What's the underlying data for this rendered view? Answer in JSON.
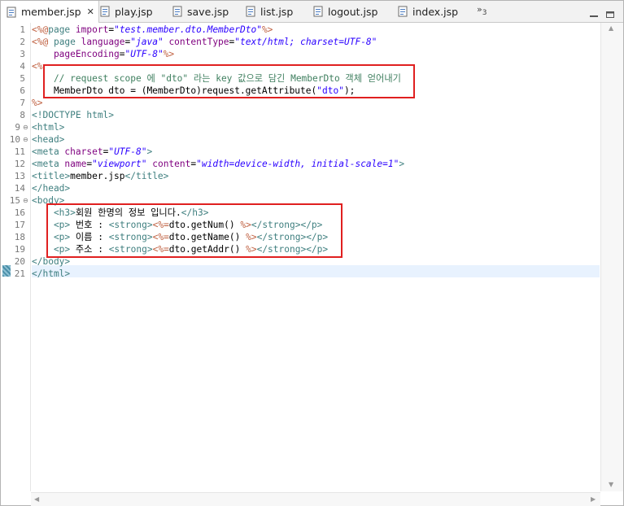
{
  "tabs": [
    {
      "label": "member.jsp",
      "active": true
    },
    {
      "label": "play.jsp"
    },
    {
      "label": "save.jsp"
    },
    {
      "label": "list.jsp"
    },
    {
      "label": "logout.jsp"
    },
    {
      "label": "index.jsp"
    }
  ],
  "overflow": {
    "glyph": "»",
    "count": "3"
  },
  "line_numbers": [
    "1",
    "2",
    "3",
    "4",
    "5",
    "6",
    "7",
    "8",
    "9",
    "10",
    "11",
    "12",
    "13",
    "14",
    "15",
    "16",
    "17",
    "18",
    "19",
    "20",
    "21"
  ],
  "code": {
    "l1": {
      "a": "<%@",
      "b": "page ",
      "c": "import",
      "d": "=",
      "e": "\"test.member.dto.MemberDto\"",
      "f": "%>"
    },
    "l2": {
      "a": "<%@",
      "b": " page ",
      "c": "language",
      "d": "=",
      "e": "\"java\"",
      "f": " contentType",
      "g": "=",
      "h": "\"text/html; charset=UTF-8\""
    },
    "l3": {
      "a": "    pageEncoding",
      "b": "=",
      "c": "\"UTF-8\"",
      "d": "%>"
    },
    "l4": {
      "a": "<%"
    },
    "l5": {
      "a": "    // request scope 에 \"dto\" 라는 key 값으로 담긴 MemberDto 객체 얻어내기"
    },
    "l6": {
      "a": "    MemberDto dto = (MemberDto)request.getAttribute(",
      "b": "\"dto\"",
      "c": ");"
    },
    "l7": {
      "a": "%>"
    },
    "l8": {
      "a": "<!DOCTYPE html>"
    },
    "l9": {
      "a": "<html>"
    },
    "l10": {
      "a": "<head>"
    },
    "l11": {
      "a": "<meta ",
      "b": "charset",
      "c": "=",
      "d": "\"UTF-8\"",
      "e": ">"
    },
    "l12": {
      "a": "<meta ",
      "b": "name",
      "c": "=",
      "d": "\"viewport\"",
      "e": " content",
      "f": "=",
      "g": "\"width=device-width, initial-scale=1\"",
      "h": ">"
    },
    "l13": {
      "a": "<title>",
      "b": "member.jsp",
      "c": "</title>"
    },
    "l14": {
      "a": "</head>"
    },
    "l15": {
      "a": "<body>"
    },
    "l16": {
      "a": "    <h3>",
      "b": "회원 한명의 정보 입니다.",
      "c": "</h3>"
    },
    "l17": {
      "a": "    <p>",
      "b": " 번호 : ",
      "c": "<strong>",
      "d": "<%=",
      "e": "dto.getNum() ",
      "f": "%>",
      "g": "</strong></p>"
    },
    "l18": {
      "a": "    <p>",
      "b": " 이름 : ",
      "c": "<strong>",
      "d": "<%=",
      "e": "dto.getName() ",
      "f": "%>",
      "g": "</strong></p>"
    },
    "l19": {
      "a": "    <p>",
      "b": " 주소 : ",
      "c": "<strong>",
      "d": "<%=",
      "e": "dto.getAddr() ",
      "f": "%>",
      "g": "</strong></p>"
    },
    "l20": {
      "a": "</body>"
    },
    "l21": {
      "a": "</html>"
    }
  },
  "colors": {
    "jsp_delim": "#bf5f3f",
    "tag": "#3f7f7f",
    "attr_name": "#7f007f",
    "attr_value": "#2a00ff",
    "comment": "#3f7f5f",
    "highlight_box": "#e02020",
    "current_line": "#e8f2fe"
  }
}
